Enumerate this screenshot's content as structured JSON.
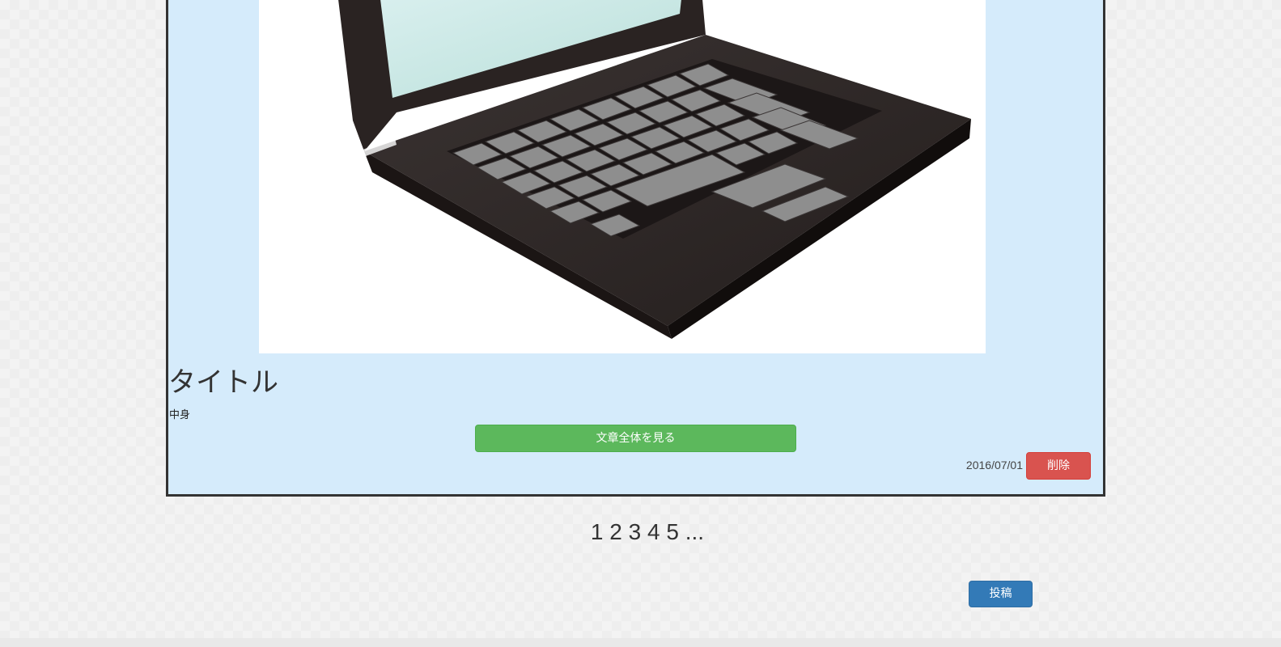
{
  "post": {
    "image_alt": "laptop illustration",
    "title": "タイトル",
    "body": "中身",
    "read_more_label": "文章全体を見る",
    "date": "2016/07/01",
    "delete_label": "削除"
  },
  "pagination": {
    "pages": [
      "1",
      "2",
      "3",
      "4",
      "5"
    ],
    "ellipsis": "..."
  },
  "actions": {
    "submit_label": "投稿"
  },
  "colors": {
    "card_background": "#d5ebfb",
    "card_border": "#333333",
    "read_more_button": "#5cb85c",
    "delete_button": "#d9534f",
    "submit_button": "#337ab7"
  }
}
